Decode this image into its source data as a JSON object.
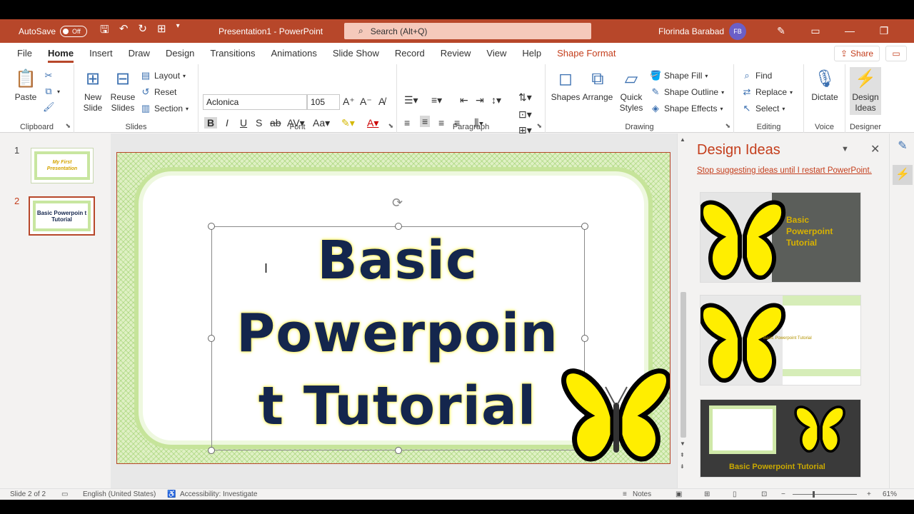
{
  "titlebar": {
    "autosave_label": "AutoSave",
    "autosave_state": "Off",
    "doc_title": "Presentation1 - PowerPoint",
    "search_placeholder": "Search (Alt+Q)",
    "user_name": "Florinda Barabad",
    "user_initials": "FB"
  },
  "tabs": [
    "File",
    "Home",
    "Insert",
    "Draw",
    "Design",
    "Transitions",
    "Animations",
    "Slide Show",
    "Record",
    "Review",
    "View",
    "Help",
    "Shape Format"
  ],
  "active_tab": "Home",
  "share_label": "Share",
  "ribbon": {
    "clipboard": {
      "label": "Clipboard",
      "paste": "Paste"
    },
    "slides": {
      "label": "Slides",
      "new_slide": "New Slide",
      "reuse_slides": "Reuse Slides",
      "layout": "Layout",
      "reset": "Reset",
      "section": "Section"
    },
    "font": {
      "label": "Font",
      "font_name": "Aclonica",
      "font_size": "105"
    },
    "paragraph": {
      "label": "Paragraph"
    },
    "drawing": {
      "label": "Drawing",
      "shapes": "Shapes",
      "arrange": "Arrange",
      "quick_styles": "Quick Styles",
      "shape_fill": "Shape Fill",
      "shape_outline": "Shape Outline",
      "shape_effects": "Shape Effects"
    },
    "editing": {
      "label": "Editing",
      "find": "Find",
      "replace": "Replace",
      "select": "Select"
    },
    "voice": {
      "label": "Voice",
      "dictate": "Dictate"
    },
    "designer": {
      "label": "Designer",
      "design_ideas": "Design Ideas"
    }
  },
  "thumbnails": [
    {
      "number": "1",
      "text": "My First Presentation"
    },
    {
      "number": "2",
      "text": "Basic Powerpoin t Tutorial"
    }
  ],
  "slide": {
    "title_lines": [
      "Basic",
      "Powerpoin",
      "t Tutorial"
    ]
  },
  "design_pane": {
    "title": "Design Ideas",
    "stop_link": "Stop suggesting ideas until I restart PowerPoint.",
    "idea1_text": "Basic Powerpoint Tutorial",
    "idea2_text": "Basic Powerpoint Tutorial",
    "idea3_text": "Basic Powerpoint Tutorial"
  },
  "statusbar": {
    "slide_info": "Slide 2 of 2",
    "language": "English (United States)",
    "accessibility": "Accessibility: Investigate",
    "notes": "Notes",
    "zoom": "61%"
  },
  "colors": {
    "accent": "#b7472a",
    "title_text": "#14264d",
    "glow": "#fff36a",
    "butterfly": "#ffee00"
  }
}
